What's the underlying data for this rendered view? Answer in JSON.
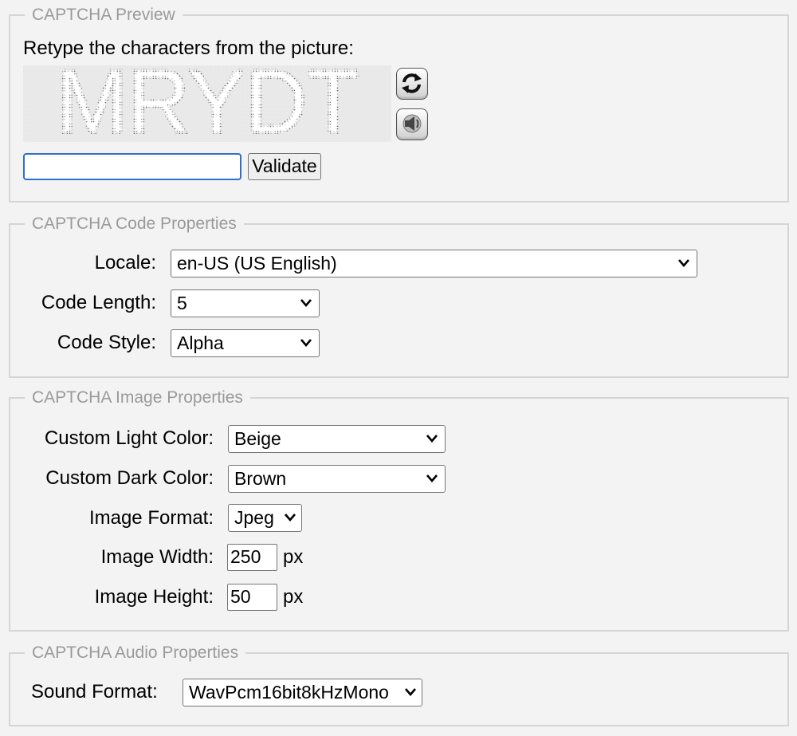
{
  "preview": {
    "legend": "CAPTCHA Preview",
    "instruction": "Retype the characters from the picture:",
    "captcha_text": "MRYDT",
    "reload_icon": "refresh-arrows-icon",
    "audio_icon": "speaker-icon",
    "input_value": "",
    "validate_label": "Validate"
  },
  "code_props": {
    "legend": "CAPTCHA Code Properties",
    "locale_label": "Locale:",
    "locale_value": "en-US (US English)",
    "length_label": "Code Length:",
    "length_value": "5",
    "style_label": "Code Style:",
    "style_value": "Alpha"
  },
  "image_props": {
    "legend": "CAPTCHA Image Properties",
    "light_label": "Custom Light Color:",
    "light_value": "Beige",
    "dark_label": "Custom Dark Color:",
    "dark_value": "Brown",
    "format_label": "Image Format:",
    "format_value": "Jpeg",
    "width_label": "Image Width:",
    "width_value": "250",
    "height_label": "Image Height:",
    "height_value": "50",
    "unit": "px"
  },
  "audio_props": {
    "legend": "CAPTCHA Audio Properties",
    "sound_label": "Sound Format:",
    "sound_value": "WavPcm16bit8kHzMono"
  }
}
